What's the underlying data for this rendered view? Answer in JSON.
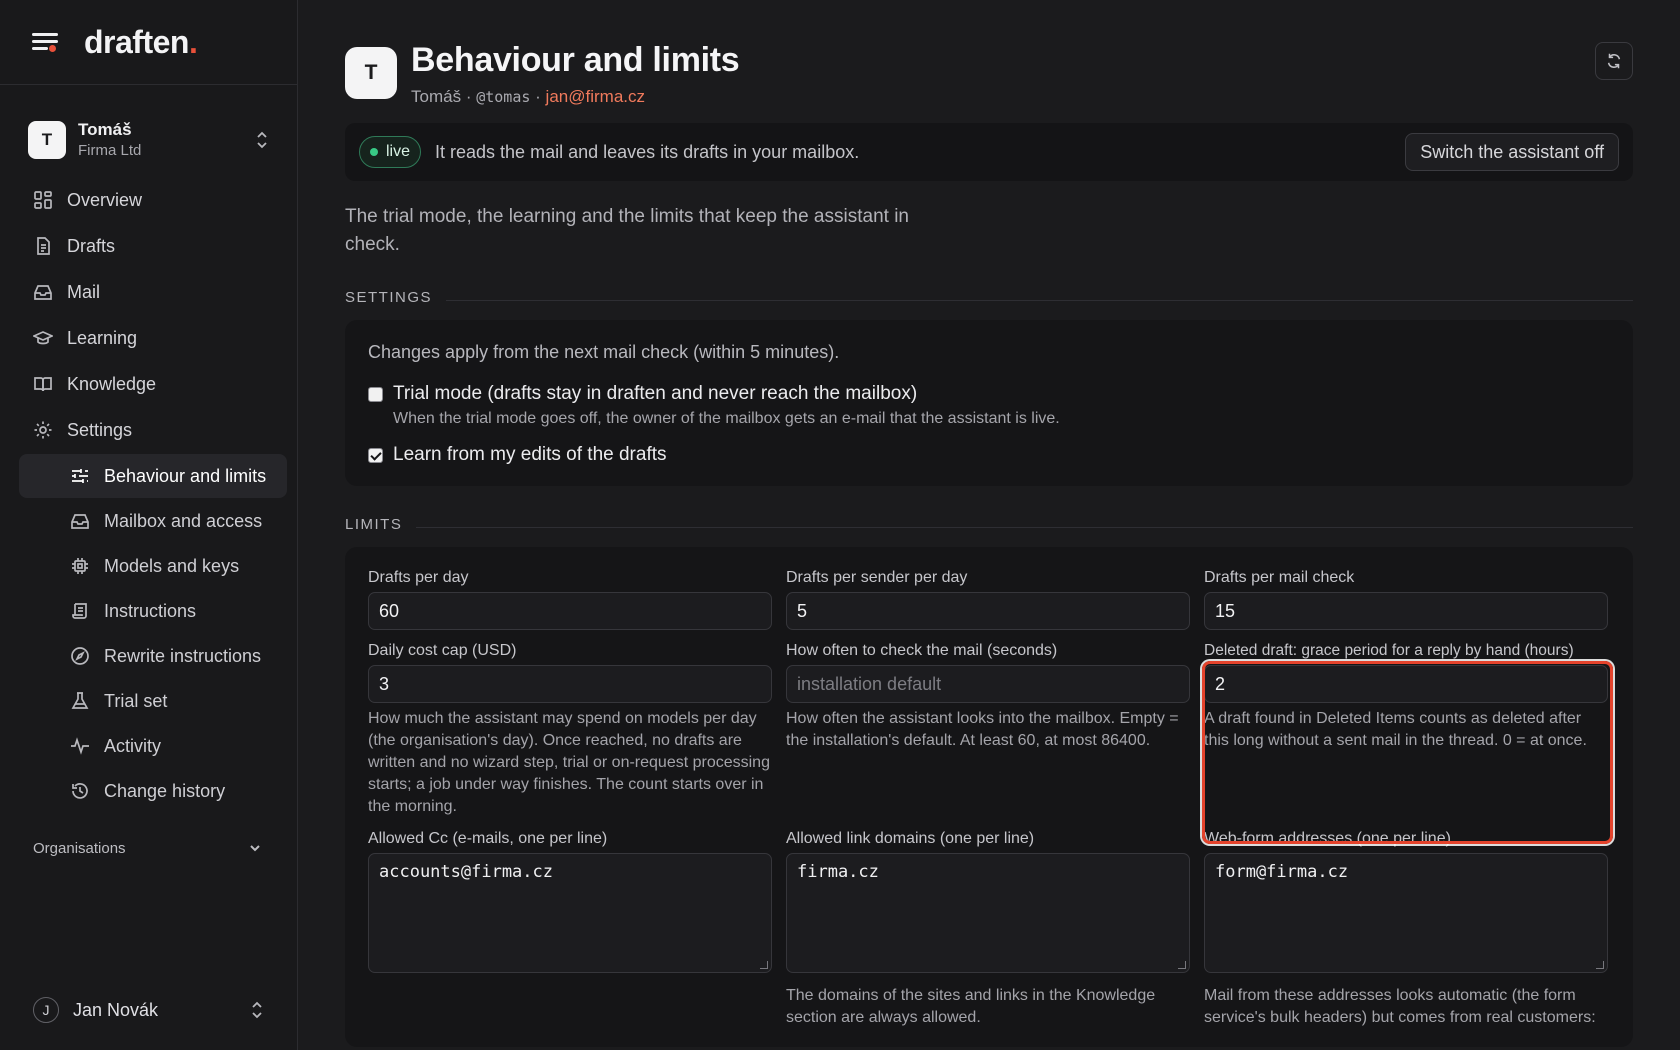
{
  "brand": {
    "name": "draften",
    "dot": "."
  },
  "account": {
    "initial": "T",
    "name": "Tomáš",
    "org": "Firma Ltd"
  },
  "nav": {
    "items": [
      {
        "label": "Overview",
        "icon": "grid-icon"
      },
      {
        "label": "Drafts",
        "icon": "file-icon"
      },
      {
        "label": "Mail",
        "icon": "inbox-icon"
      },
      {
        "label": "Learning",
        "icon": "graduation-cap-icon"
      },
      {
        "label": "Knowledge",
        "icon": "book-icon"
      },
      {
        "label": "Settings",
        "icon": "gear-icon"
      }
    ],
    "sub_items": [
      {
        "label": "Behaviour and limits",
        "icon": "sliders-icon",
        "active": true
      },
      {
        "label": "Mailbox and access",
        "icon": "inbox-icon"
      },
      {
        "label": "Models and keys",
        "icon": "chip-icon"
      },
      {
        "label": "Instructions",
        "icon": "scroll-icon"
      },
      {
        "label": "Rewrite instructions",
        "icon": "compass-icon"
      },
      {
        "label": "Trial set",
        "icon": "flask-icon"
      },
      {
        "label": "Activity",
        "icon": "activity-icon"
      },
      {
        "label": "Change history",
        "icon": "history-icon"
      }
    ],
    "organisations_label": "Organisations"
  },
  "user": {
    "initial": "J",
    "name": "Jan Novák"
  },
  "header": {
    "initial": "T",
    "title": "Behaviour and limits",
    "name": "Tomáš",
    "handle": "@tomas",
    "email": "jan@firma.cz",
    "sep": "·"
  },
  "status": {
    "badge": "live",
    "text": "It reads the mail and leaves its drafts in your mailbox.",
    "switch_button": "Switch the assistant off"
  },
  "intro": "The trial mode, the learning and the limits that keep the assistant in check.",
  "settings": {
    "section_label": "SETTINGS",
    "note": "Changes apply from the next mail check (within 5 minutes).",
    "trial_mode": {
      "label": "Trial mode (drafts stay in draften and never reach the mailbox)",
      "help": "When the trial mode goes off, the owner of the mailbox gets an e-mail that the assistant is live.",
      "checked": false
    },
    "learn_edits": {
      "label": "Learn from my edits of the drafts",
      "checked": true
    }
  },
  "limits": {
    "section_label": "LIMITS",
    "drafts_per_day": {
      "label": "Drafts per day",
      "value": "60"
    },
    "drafts_per_sender": {
      "label": "Drafts per sender per day",
      "value": "5"
    },
    "drafts_per_check": {
      "label": "Drafts per mail check",
      "value": "15"
    },
    "daily_cost_cap": {
      "label": "Daily cost cap (USD)",
      "value": "3",
      "help": "How much the assistant may spend on models per day (the organisation's day). Once reached, no drafts are written and no wizard step, trial or on-request processing starts; a job under way finishes. The count starts over in the morning."
    },
    "check_interval": {
      "label": "How often to check the mail (seconds)",
      "placeholder": "installation default",
      "help": "How often the assistant looks into the mailbox. Empty = the installation's default. At least 60, at most 86400."
    },
    "grace_period": {
      "label": "Deleted draft: grace period for a reply by hand (hours)",
      "value": "2",
      "help": "A draft found in Deleted Items counts as deleted after this long without a sent mail in the thread. 0 = at once."
    },
    "allowed_cc": {
      "label": "Allowed Cc (e-mails, one per line)",
      "value": "accounts@firma.cz"
    },
    "allowed_domains": {
      "label": "Allowed link domains (one per line)",
      "value": "firma.cz",
      "help": "The domains of the sites and links in the Knowledge section are always allowed."
    },
    "webform_addresses": {
      "label": "Web-form addresses (one per line)",
      "value": "form@firma.cz",
      "help": "Mail from these addresses looks automatic (the form service's bulk headers) but comes from real customers:"
    }
  },
  "colors": {
    "accent": "#e8503a",
    "email": "#f07a5c",
    "live": "#38c985",
    "highlight": "#e4432c"
  }
}
